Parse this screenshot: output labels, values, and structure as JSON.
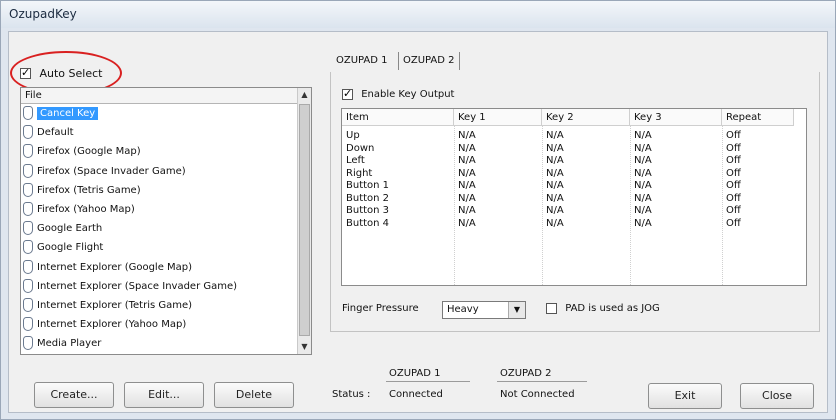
{
  "window": {
    "title": "OzupadKey"
  },
  "left": {
    "auto_select": {
      "label": "Auto Select",
      "checked": true
    },
    "list": {
      "header": "File",
      "items": [
        {
          "label": "Cancel Key",
          "selected": true
        },
        {
          "label": "Default",
          "selected": false
        },
        {
          "label": "Firefox (Google Map)",
          "selected": false
        },
        {
          "label": "Firefox (Space Invader Game)",
          "selected": false
        },
        {
          "label": "Firefox (Tetris Game)",
          "selected": false
        },
        {
          "label": "Firefox (Yahoo Map)",
          "selected": false
        },
        {
          "label": "Google Earth",
          "selected": false
        },
        {
          "label": "Google Flight",
          "selected": false
        },
        {
          "label": "Internet Explorer (Google Map)",
          "selected": false
        },
        {
          "label": "Internet Explorer (Space Invader Game)",
          "selected": false
        },
        {
          "label": "Internet Explorer (Tetris Game)",
          "selected": false
        },
        {
          "label": "Internet Explorer (Yahoo Map)",
          "selected": false
        },
        {
          "label": "Media Player",
          "selected": false
        }
      ]
    },
    "buttons": {
      "create": "Create...",
      "edit": "Edit...",
      "delete": "Delete"
    }
  },
  "tabs": [
    {
      "label": "OZUPAD 1",
      "active": true
    },
    {
      "label": "OZUPAD 2",
      "active": false
    }
  ],
  "panel": {
    "enable_output": {
      "label": "Enable Key Output",
      "checked": true
    },
    "table": {
      "columns": [
        "Item",
        "Key 1",
        "Key 2",
        "Key 3",
        "Repeat"
      ],
      "rows": [
        [
          "Up",
          "N/A",
          "N/A",
          "N/A",
          "Off"
        ],
        [
          "Down",
          "N/A",
          "N/A",
          "N/A",
          "Off"
        ],
        [
          "Left",
          "N/A",
          "N/A",
          "N/A",
          "Off"
        ],
        [
          "Right",
          "N/A",
          "N/A",
          "N/A",
          "Off"
        ],
        [
          "Button 1",
          "N/A",
          "N/A",
          "N/A",
          "Off"
        ],
        [
          "Button 2",
          "N/A",
          "N/A",
          "N/A",
          "Off"
        ],
        [
          "Button 3",
          "N/A",
          "N/A",
          "N/A",
          "Off"
        ],
        [
          "Button 4",
          "N/A",
          "N/A",
          "N/A",
          "Off"
        ]
      ]
    },
    "finger_pressure": {
      "label": "Finger Pressure",
      "value": "Heavy"
    },
    "jog": {
      "label": "PAD is used as JOG",
      "checked": false
    }
  },
  "status": {
    "label": "Status :",
    "pad1": {
      "name": "OZUPAD 1",
      "value": "Connected"
    },
    "pad2": {
      "name": "OZUPAD 2",
      "value": "Not Connected"
    }
  },
  "footer": {
    "exit": "Exit",
    "close": "Close"
  },
  "colors": {
    "selection": "#3399ff",
    "highlight_circle": "#d92020"
  }
}
